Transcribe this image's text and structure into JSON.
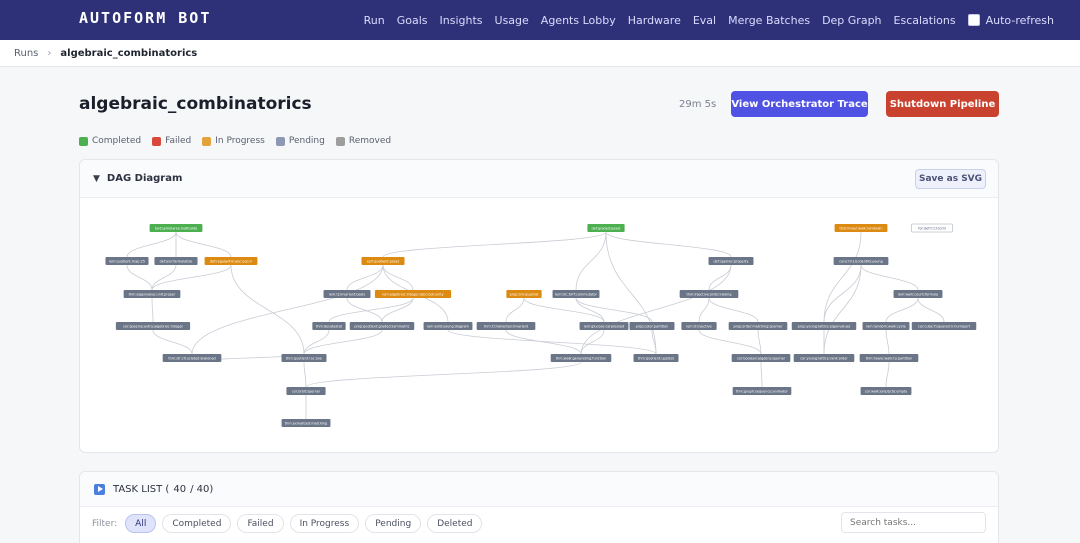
{
  "app": {
    "logo": "AUTOFORM BOT"
  },
  "nav": {
    "items": [
      "Run",
      "Goals",
      "Insights",
      "Usage",
      "Agents Lobby",
      "Hardware",
      "Eval",
      "Merge Batches",
      "Dep Graph",
      "Escalations"
    ],
    "auto_refresh_label": "Auto-refresh"
  },
  "breadcrumb": {
    "root": "Runs",
    "separator": "›",
    "current": "algebraic_combinatorics"
  },
  "header": {
    "title": "algebraic_combinatorics",
    "elapsed": "29m 5s",
    "trace_button": "View Orchestrator Trace",
    "shutdown_button": "Shutdown Pipeline"
  },
  "legend": [
    {
      "label": "Completed",
      "color": "#4caf50"
    },
    {
      "label": "Failed",
      "color": "#d9483b"
    },
    {
      "label": "In Progress",
      "color": "#e2a33a"
    },
    {
      "label": "Pending",
      "color": "#8e98b4"
    },
    {
      "label": "Removed",
      "color": "#9e9e9e"
    }
  ],
  "colors": {
    "completed": "#4caf50",
    "in_progress": "#dc8a12",
    "pending": "#6b7588",
    "white_node": "#ffffff",
    "edge": "#c8ccd4"
  },
  "dag": {
    "section_title": "DAG Diagram",
    "save_label": "Save as SVG",
    "nodes": [
      {
        "id": "n1",
        "label": "bwt:symbiarse:inoficolde",
        "status": "completed"
      },
      {
        "id": "n2",
        "label": "def:graded:poset",
        "status": "completed"
      },
      {
        "id": "n3",
        "label": "thm:linear:walk:rambrain",
        "status": "in_progress"
      },
      {
        "id": "n4",
        "label": "for:def:t:1:tccntl",
        "status": "white"
      },
      {
        "id": "n5",
        "label": "lem:quotient:map:25",
        "status": "pending"
      },
      {
        "id": "n6",
        "label": "def:asn:farmolatize",
        "status": "pending"
      },
      {
        "id": "n7",
        "label": "def:regularitm:abc:eqn:n",
        "status": "in_progress"
      },
      {
        "id": "n8",
        "label": "sprl:quotient:poset",
        "status": "in_progress"
      },
      {
        "id": "n9",
        "label": "def:sperner:property",
        "status": "pending"
      },
      {
        "id": "n10",
        "label": "cons:t0:LG:identify:young",
        "status": "pending"
      },
      {
        "id": "n11",
        "label": "thm:eigenvalue:unit:proper",
        "status": "pending"
      },
      {
        "id": "n12",
        "label": "lem:Q:invariant:basis",
        "status": "pending"
      },
      {
        "id": "n13",
        "label": "lem:algebraic:integer:abs:root:unity",
        "status": "in_progress"
      },
      {
        "id": "n14",
        "label": "prop:bm:quadrat",
        "status": "in_progress"
      },
      {
        "id": "n15",
        "label": "lem:GC:bVT:commutator",
        "status": "pending"
      },
      {
        "id": "n16",
        "label": "thm:injective:order:raising",
        "status": "pending"
      },
      {
        "id": "n17",
        "label": "lem:walk:count:formula",
        "status": "pending"
      },
      {
        "id": "n18",
        "label": "cor:speerse:extrq:algebraic:integer",
        "status": "pending"
      },
      {
        "id": "n19",
        "label": "thm:decatastat",
        "status": "pending"
      },
      {
        "id": "n20",
        "label": "prop:quotient:graded:symmetric",
        "status": "pending"
      },
      {
        "id": "n21",
        "label": "lem:edid:young:diagram",
        "status": "pending"
      },
      {
        "id": "n22",
        "label": "thm:t:trialvertex:invariant",
        "status": "pending"
      },
      {
        "id": "n23",
        "label": "lem:glucose:carpressed",
        "status": "pending"
      },
      {
        "id": "n24",
        "label": "prop:color:partition",
        "status": "pending"
      },
      {
        "id": "n25",
        "label": "lem:U:injective",
        "status": "pending"
      },
      {
        "id": "n26",
        "label": "prop:order:matching:sperner",
        "status": "pending"
      },
      {
        "id": "n27",
        "label": "prop:young:lattice:eigenvalues",
        "status": "pending"
      },
      {
        "id": "n28",
        "label": "lem:random:walk:cycle",
        "status": "pending"
      },
      {
        "id": "n29",
        "label": "cor:cube:f:squared:n:hurinport",
        "status": "pending"
      },
      {
        "id": "n30",
        "label": "thm:str:cfcuclated:lewioned",
        "status": "pending"
      },
      {
        "id": "n31",
        "label": "thm:quotient:rac:one",
        "status": "pending"
      },
      {
        "id": "n32",
        "label": "thm:walk:generating:function",
        "status": "pending"
      },
      {
        "id": "n33",
        "label": "thm:quotient:upsstat",
        "status": "pending"
      },
      {
        "id": "n34",
        "label": "cor:boolean:algebra:sperner",
        "status": "pending"
      },
      {
        "id": "n35",
        "label": "cor:young:lattice:rank:order",
        "status": "pending"
      },
      {
        "id": "n36",
        "label": "thm:hoare:walk:to:partition",
        "status": "pending"
      },
      {
        "id": "n37",
        "label": "cor:orbit:sperner",
        "status": "pending"
      },
      {
        "id": "n38",
        "label": "thm:graph:sequence:animator",
        "status": "pending"
      },
      {
        "id": "n39",
        "label": "cor:walk:empty:to:empty",
        "status": "pending"
      },
      {
        "id": "n40",
        "label": "thm:exmalized:matching",
        "status": "pending"
      }
    ]
  },
  "tasks": {
    "section_title": "TASK LIST (",
    "shown": "40",
    "total": "/ 40)",
    "filter_label": "Filter:",
    "filters": [
      "All",
      "Completed",
      "Failed",
      "In Progress",
      "Pending",
      "Deleted"
    ],
    "active_filter": "All",
    "search_placeholder": "Search tasks..."
  }
}
